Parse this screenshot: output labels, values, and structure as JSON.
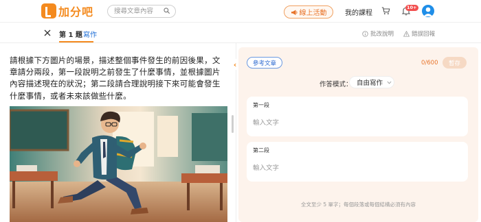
{
  "brand": {
    "logo_text": "加分吧",
    "accent": "#f48a1e"
  },
  "search": {
    "placeholder": "搜尋文章內容"
  },
  "nav": {
    "event_label": "線上活動",
    "courses_label": "我的課程",
    "notification_badge": "10+",
    "icons": [
      "cart-icon",
      "bell-icon",
      "user-avatar"
    ]
  },
  "question_bar": {
    "title": "第 1 題",
    "type": "寫作",
    "help_label": "批改說明",
    "report_label": "錯誤回報"
  },
  "prompt": {
    "text": "請根據下方圖片的場景，描述整個事件發生的前因後果，文章請分兩段，第一段說明之前發生了什麼事情，並根據圖片內容描述現在的狀況；第二段請合理說明接下來可能會發生什麼事情，或者未來該做些什麼。"
  },
  "editor": {
    "reference_label": "參考文章",
    "word_count": "0/600",
    "save_label": "暫存",
    "mode_label": "作答模式：",
    "mode_value": "自由寫作",
    "paragraphs": [
      {
        "label": "第一段",
        "placeholder": "輸入文字"
      },
      {
        "label": "第二段",
        "placeholder": "輸入文字"
      }
    ],
    "hint": "全文至少 5 單字；每個段落或每個結構必須有內容"
  },
  "colors": {
    "link_blue": "#1f6fd6",
    "editor_bg": "#fdf3ec",
    "save_disabled": "#f6d9c4"
  }
}
